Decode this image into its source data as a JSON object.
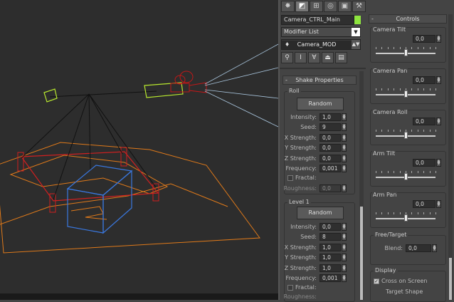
{
  "colors": {
    "accent_green": "#8ee53f",
    "ui_bg": "#444444",
    "viewport_bg": "#2d2d2d"
  },
  "command_panel": {
    "tab_icons": [
      "sun-gear-icon",
      "curve-icon",
      "hierarchy-icon",
      "motion-icon",
      "display-icon",
      "hammer-icon"
    ],
    "object_name": "Camera_CTRL_Main",
    "modifier_list": "Modifier List",
    "stack_item": "Camera_MOD",
    "stack_tool_icons": [
      "pin-icon",
      "show-end-icon",
      "make-unique-icon",
      "remove-modifier-icon",
      "configure-icon"
    ]
  },
  "shake": {
    "title": "Shake Properties",
    "collapse": "-",
    "roll": {
      "group": "Roll",
      "random_button": "Random",
      "fields": [
        {
          "label": "Intensity:",
          "value": "1,0"
        },
        {
          "label": "Seed:",
          "value": "9"
        },
        {
          "label": "X Strength:",
          "value": "0,0"
        },
        {
          "label": "Y Strength:",
          "value": "0,0"
        },
        {
          "label": "Z Strength:",
          "value": "0,0"
        },
        {
          "label": "Frequency:",
          "value": "0,001"
        }
      ],
      "fractal": "Fractal:",
      "roughness_label": "Roughness:",
      "roughness_value": "0,0"
    },
    "level1": {
      "group": "Level 1",
      "random_button": "Random",
      "fields": [
        {
          "label": "Intensity:",
          "value": "0,0"
        },
        {
          "label": "Seed:",
          "value": "8"
        },
        {
          "label": "X Strength:",
          "value": "1,0"
        },
        {
          "label": "Y Strength:",
          "value": "1,0"
        },
        {
          "label": "Z Strength:",
          "value": "1,0"
        },
        {
          "label": "Frequency:",
          "value": "0,001"
        }
      ],
      "fractal": "Fractal:",
      "roughness_label": "Roughness:"
    }
  },
  "controls": {
    "title": "Controls",
    "collapse": "-",
    "sliders": [
      {
        "label": "Camera Tilt",
        "value": "0,0",
        "level": 0.5
      },
      {
        "label": "Camera Pan",
        "value": "0,0",
        "level": 0.5
      },
      {
        "label": "Camera Roll",
        "value": "0,0",
        "level": 0.5
      },
      {
        "label": "Arm Tilt",
        "value": "0,0",
        "level": 0.5
      },
      {
        "label": "Arm Pan",
        "value": "0,0",
        "level": 0.5
      }
    ],
    "free_target": {
      "group": "Free/Target",
      "blend_label": "Blend:",
      "blend_value": "0,0"
    },
    "display": {
      "group": "Display",
      "cross_on_screen": "Cross on Screen",
      "cross_checked": true,
      "target_shape": "Target Shape"
    }
  }
}
